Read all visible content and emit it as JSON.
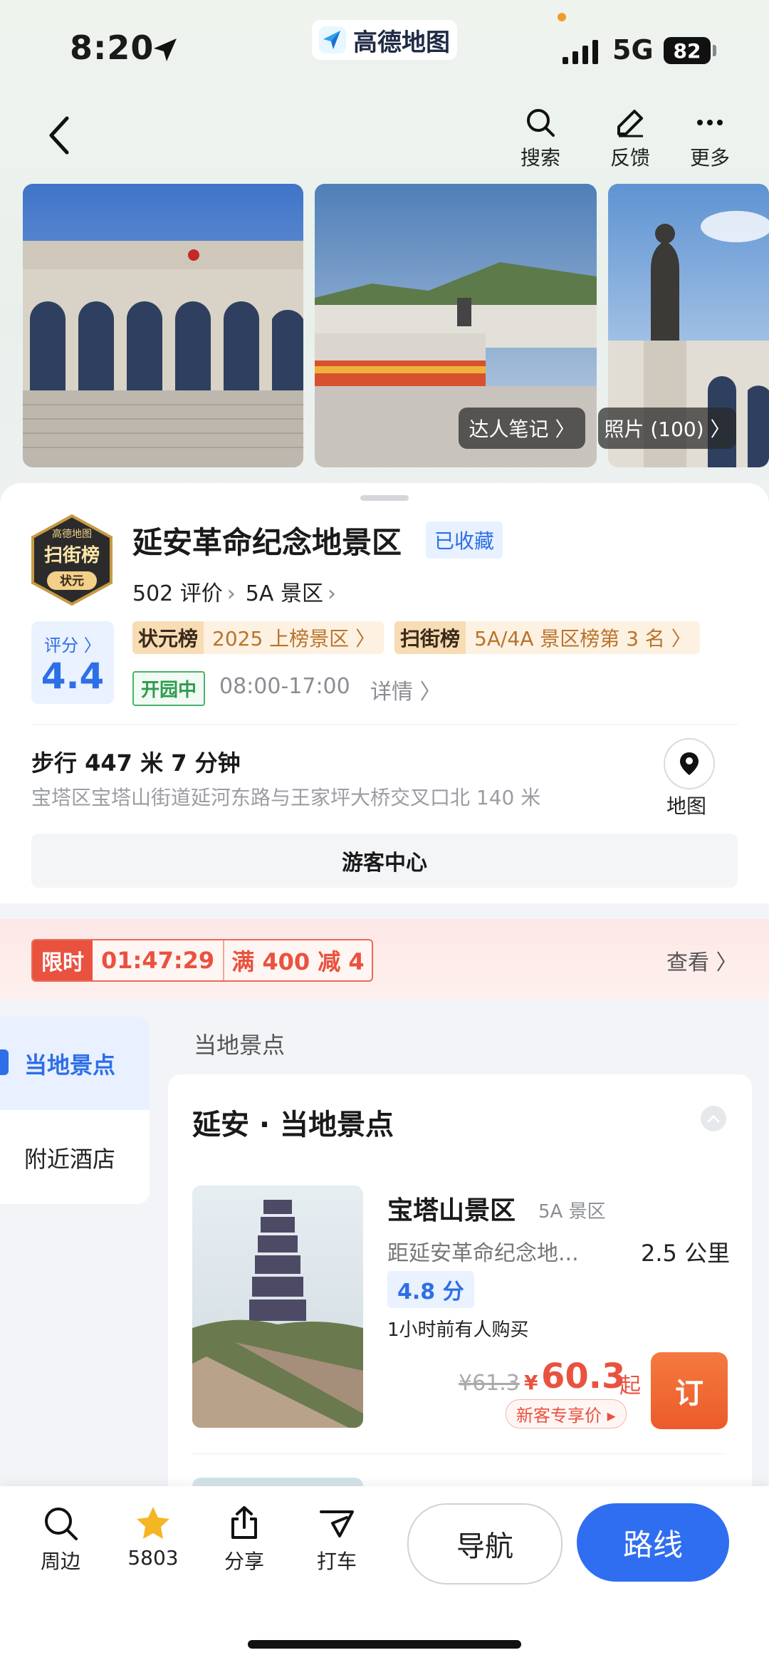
{
  "status_bar": {
    "time": "8:20",
    "network": "5G",
    "battery": "82"
  },
  "brand": {
    "name": "高德地图"
  },
  "top_nav": {
    "search_label": "搜索",
    "feedback_label": "反馈",
    "more_label": "更多"
  },
  "photos": {
    "notes_tag": "达人笔记 〉",
    "photos_tag": "照片 (100) 〉"
  },
  "poi": {
    "badge_top": "高德地图",
    "badge_mid": "扫街榜",
    "badge_bottom": "状元",
    "title": "延安革命纪念地景区",
    "favorited": "已收藏",
    "reviews": "502 评价",
    "level": "5A 景区",
    "score_label": "评分 〉",
    "score": "4.4",
    "rank1_name": "状元榜",
    "rank1_text": "2025 上榜景区 〉",
    "rank2_name": "扫街榜",
    "rank2_text": "5A/4A 景区榜第 3 名 〉",
    "open_status": "开园中",
    "hours": "08:00-17:00",
    "details": "详情 〉",
    "walk": "步行 447 米  7 分钟",
    "address": "宝塔区宝塔山街道延河东路与王家坪大桥交叉口北 140 米",
    "map_label": "地图",
    "visitor_center": "游客中心"
  },
  "promo": {
    "limited": "限时",
    "countdown": "01:47:29",
    "offer": "满 400 减 4",
    "view": "查看 〉"
  },
  "side_tabs": {
    "tab1": "当地景点",
    "tab2": "附近酒店"
  },
  "section": {
    "label": "当地景点",
    "card_title": "延安 · 当地景点"
  },
  "items": [
    {
      "name": "宝塔山景区",
      "level": "5A 景区",
      "dist_desc": "距延安革命纪念地...",
      "dist": "2.5 公里",
      "score": "4.8 分",
      "bought": "1小时前有人购买",
      "old_price": "¥61.3",
      "yen": "¥",
      "price": "60.3",
      "price_suffix": "起",
      "new_tag": "新客专享价 ▸",
      "book": "订"
    }
  ],
  "bottom_bar": {
    "nearby": "周边",
    "stars": "5803",
    "share": "分享",
    "taxi": "打车",
    "navigate": "导航",
    "route": "路线"
  },
  "colors": {
    "accent": "#2f6ef0",
    "promo": "#e9523f",
    "open": "#2f9b50",
    "star": "#f5b625"
  }
}
